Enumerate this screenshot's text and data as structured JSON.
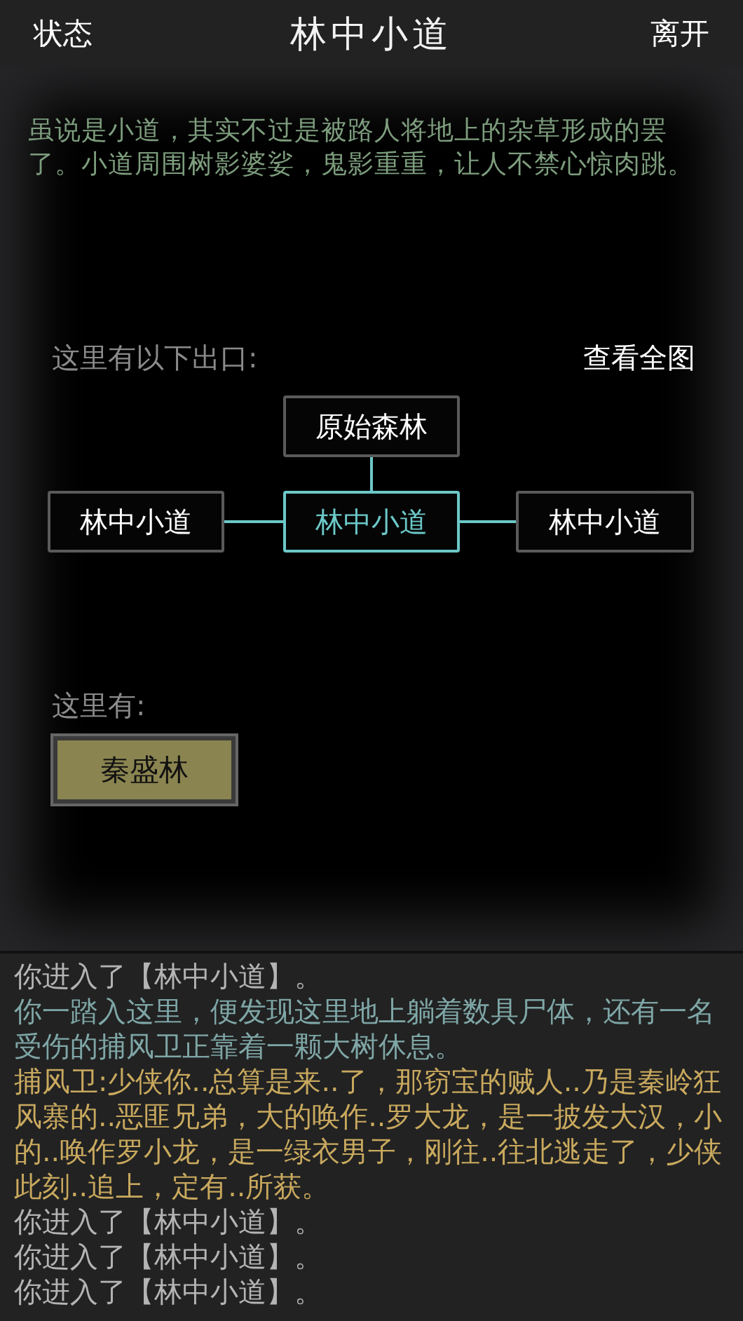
{
  "header": {
    "left_button": "状态",
    "title": "林中小道",
    "right_button": "离开"
  },
  "description": "虽说是小道，其实不过是被路人将地上的杂草形成的罢了。小道周围树影婆娑，鬼影重重，让人不禁心惊肉跳。",
  "exits": {
    "label": "这里有以下出口:",
    "map_link": "查看全图",
    "rooms": [
      {
        "kind": "north",
        "name": "原始森林",
        "selected": false
      },
      {
        "kind": "west",
        "name": "林中小道",
        "selected": false
      },
      {
        "kind": "center",
        "name": "林中小道",
        "selected": true
      },
      {
        "kind": "east",
        "name": "林中小道",
        "selected": false
      }
    ]
  },
  "present": {
    "label": "这里有:",
    "npcs": [
      "秦盛林"
    ]
  },
  "log": [
    {
      "kind": "system",
      "text": "你进入了【林中小道】。"
    },
    {
      "kind": "description",
      "text": "你一踏入这里，便发现这里地上躺着数具尸体，还有一名受伤的捕风卫正靠着一颗大树休息。"
    },
    {
      "kind": "speech",
      "text": "捕风卫:少侠你..总算是来..了，那窃宝的贼人..乃是秦岭狂风寨的..恶匪兄弟，大的唤作..罗大龙，是一披发大汉，小的..唤作罗小龙，是一绿衣男子，刚往..往北逃走了，少侠此刻..追上，定有..所获。"
    },
    {
      "kind": "system",
      "text": "你进入了【林中小道】。"
    },
    {
      "kind": "system",
      "text": "你进入了【林中小道】。"
    },
    {
      "kind": "system",
      "text": "你进入了【林中小道】。"
    }
  ]
}
